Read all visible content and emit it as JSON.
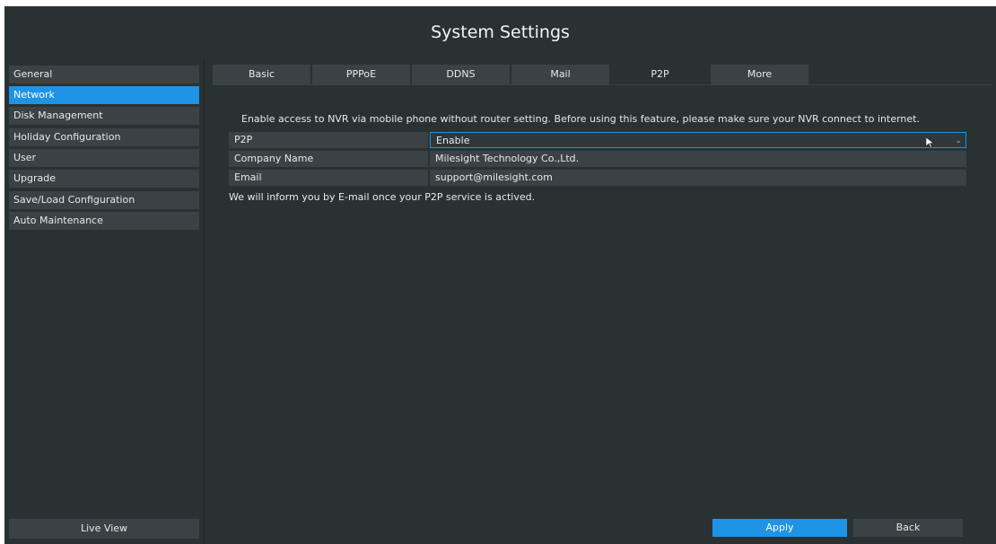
{
  "window": {
    "title": "System Settings"
  },
  "sidebar": {
    "items": [
      {
        "label": "General"
      },
      {
        "label": "Network"
      },
      {
        "label": "Disk Management"
      },
      {
        "label": "Holiday Configuration"
      },
      {
        "label": "User"
      },
      {
        "label": "Upgrade"
      },
      {
        "label": "Save/Load Configuration"
      },
      {
        "label": "Auto Maintenance"
      }
    ],
    "active_item": "Network",
    "live_view_label": "Live View"
  },
  "tabs": [
    {
      "label": "Basic"
    },
    {
      "label": "PPPoE"
    },
    {
      "label": "DDNS"
    },
    {
      "label": "Mail"
    },
    {
      "label": "P2P"
    },
    {
      "label": "More"
    }
  ],
  "active_tab": "P2P",
  "p2p": {
    "intro": "Enable access to NVR via mobile phone without router setting. Before using this feature, please make sure your NVR connect to internet.",
    "fields": [
      {
        "label": "P2P",
        "value": "Enable"
      },
      {
        "label": "Company Name",
        "value": "Milesight Technology Co.,Ltd."
      },
      {
        "label": "Email",
        "value": "support@milesight.com"
      }
    ],
    "note": "We will inform you by E-mail once your P2P service is actived."
  },
  "buttons": {
    "apply": "Apply",
    "back": "Back"
  },
  "colors": {
    "background": "#2a3133",
    "panel": "#3a4245",
    "accent": "#1f93e6"
  }
}
